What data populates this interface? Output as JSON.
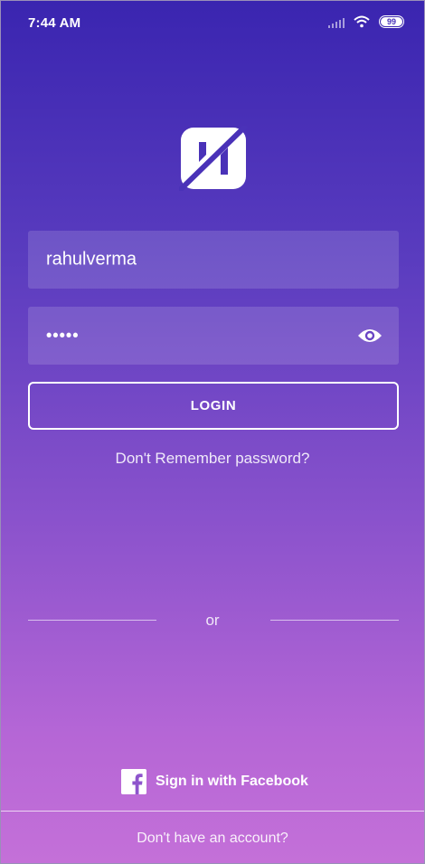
{
  "status_bar": {
    "time": "7:44 AM",
    "battery_level": "99",
    "icons": [
      "signal-icon",
      "wifi-icon",
      "battery-icon"
    ]
  },
  "logo": {
    "icon": "app-logo-icon"
  },
  "login_form": {
    "username_value": "rahulverma",
    "password_mask": "•••••",
    "show_password_icon": "eye-icon",
    "login_label": "LOGIN",
    "forgot_password_label": "Don't Remember password?"
  },
  "divider": {
    "label": "or"
  },
  "social": {
    "facebook_label": "Sign in with Facebook",
    "facebook_icon": "facebook-icon"
  },
  "footer": {
    "signup_prompt": "Don't have an account?"
  },
  "colors": {
    "gradient_top": "#3a25b0",
    "gradient_bottom": "#c470d8",
    "text": "#ffffff"
  }
}
